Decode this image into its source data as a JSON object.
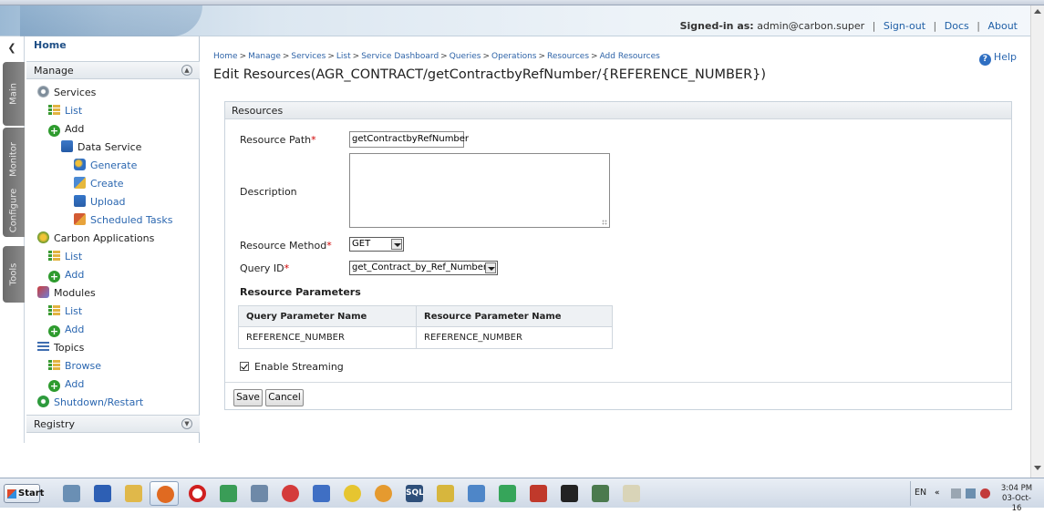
{
  "header": {
    "signed_label": "Signed-in as:",
    "signed_user": "admin@carbon.super",
    "sign_out": "Sign-out",
    "docs": "Docs",
    "about": "About"
  },
  "vtabs": [
    "Main",
    "Monitor",
    "Configure",
    "Tools"
  ],
  "sidebar": {
    "home": "Home",
    "manage": "Manage",
    "registry": "Registry",
    "items": [
      {
        "label": "Services"
      },
      {
        "label": "List"
      },
      {
        "label": "Add"
      },
      {
        "label": "Data Service"
      },
      {
        "label": "Generate"
      },
      {
        "label": "Create"
      },
      {
        "label": "Upload"
      },
      {
        "label": "Scheduled Tasks"
      },
      {
        "label": "Carbon Applications"
      },
      {
        "label": "List"
      },
      {
        "label": "Add"
      },
      {
        "label": "Modules"
      },
      {
        "label": "List"
      },
      {
        "label": "Add"
      },
      {
        "label": "Topics"
      },
      {
        "label": "Browse"
      },
      {
        "label": "Add"
      },
      {
        "label": "Shutdown/Restart"
      }
    ]
  },
  "breadcrumb": [
    "Home",
    "Manage",
    "Services",
    "List",
    "Service Dashboard",
    "Queries",
    "Operations",
    "Resources",
    "Add Resources"
  ],
  "help": "Help",
  "page_title": "Edit Resources(AGR_CONTRACT/getContractbyRefNumber/{REFERENCE_NUMBER})",
  "form": {
    "panel_title": "Resources",
    "resource_path_label": "Resource Path",
    "resource_path_value": "getContractbyRefNumber",
    "description_label": "Description",
    "description_value": "",
    "method_label": "Resource Method",
    "method_value": "GET",
    "query_id_label": "Query ID",
    "query_id_value": "get_Contract_by_Ref_Number",
    "required_mark": "*",
    "params_title": "Resource Parameters",
    "params_headers": [
      "Query Parameter Name",
      "Resource Parameter Name"
    ],
    "params_rows": [
      [
        "REFERENCE_NUMBER",
        "REFERENCE_NUMBER"
      ]
    ],
    "streaming_label": "Enable Streaming",
    "streaming_checked": true,
    "save": "Save",
    "cancel": "Cancel"
  },
  "taskbar": {
    "start": "Start",
    "sql_icon_text": "SQL",
    "lang": "EN",
    "time": "3:04 PM",
    "date": "03-Oct-16"
  },
  "colors": {
    "link": "#2b67b0",
    "required": "#d00000"
  }
}
